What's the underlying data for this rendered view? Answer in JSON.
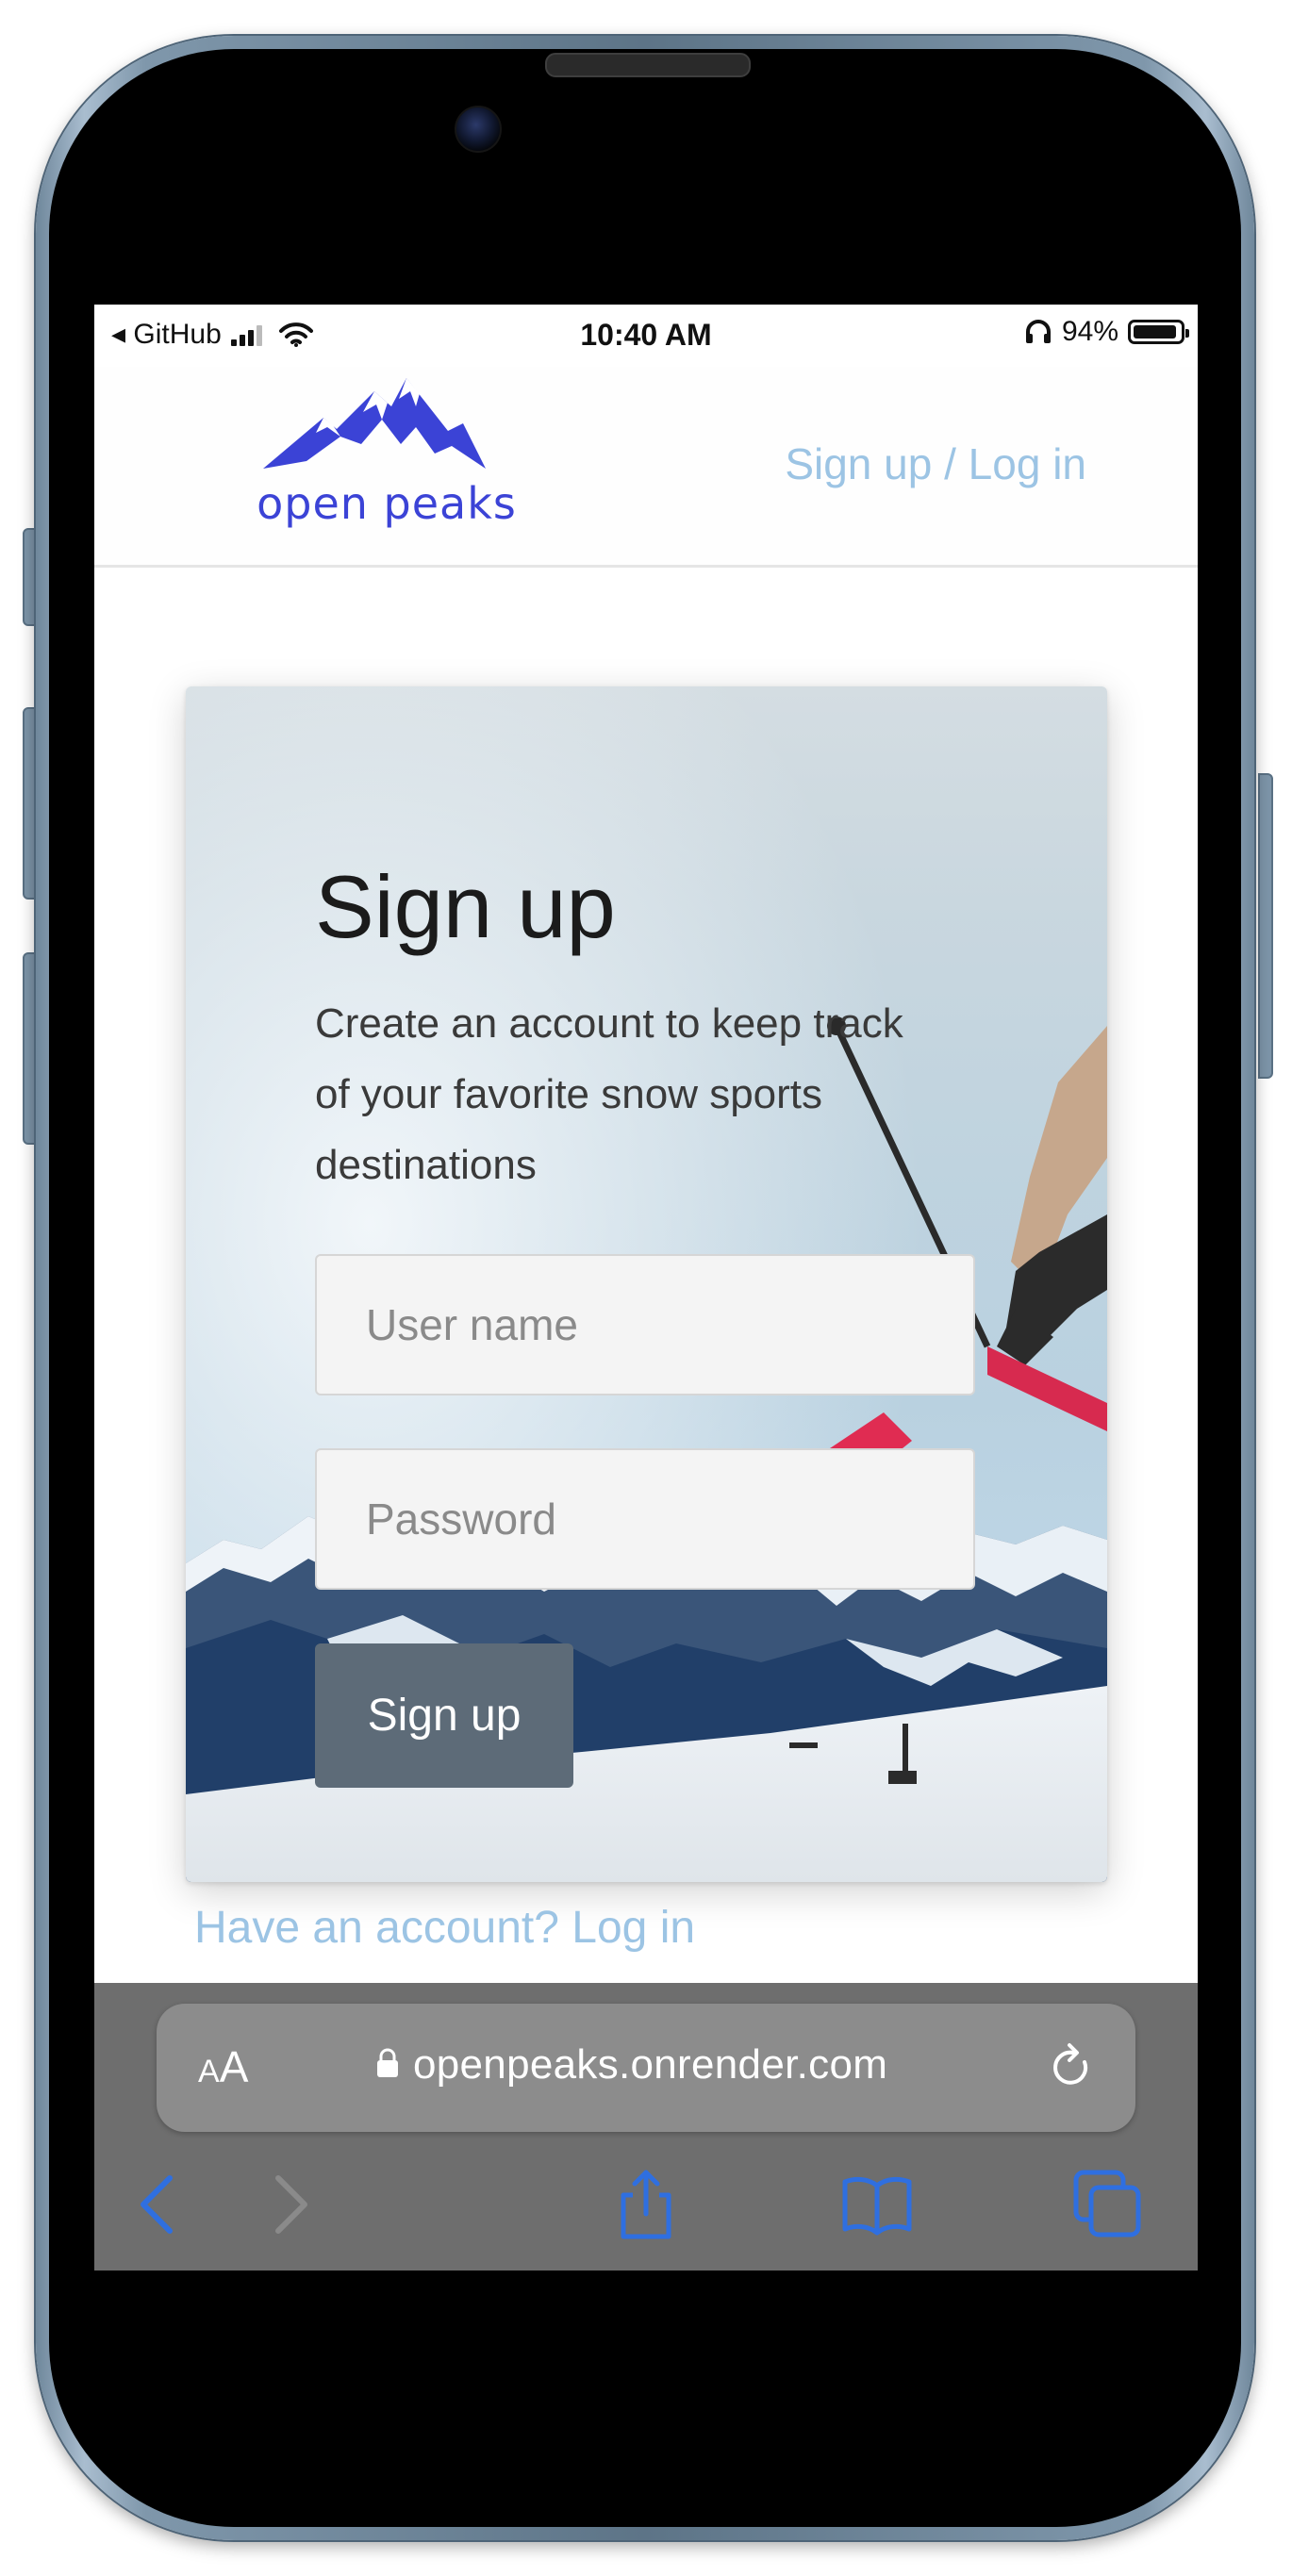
{
  "status_bar": {
    "back_app": "◂ GitHub",
    "time": "10:40 AM",
    "battery_percent": "94%",
    "battery_level": 0.94
  },
  "site_header": {
    "logo_text": "open peaks",
    "nav_link": "Sign up / Log in"
  },
  "signup_card": {
    "title": "Sign up",
    "description": "Create an account to keep track of your favorite snow sports destinations",
    "username_placeholder": "User name",
    "password_placeholder": "Password",
    "submit_label": "Sign up"
  },
  "login_link": "Have an account? Log in",
  "browser": {
    "text_size_label_small": "A",
    "text_size_label_large": "A",
    "url": "openpeaks.onrender.com",
    "toolbar": [
      "back",
      "forward",
      "share",
      "bookmarks",
      "tabs"
    ]
  },
  "colors": {
    "link": "#9cc4e4",
    "logo": "#3b43d6",
    "button": "#5d6b78",
    "browser_chrome": "#6e6e6e",
    "toolbar_icon": "#2f6fe0"
  }
}
